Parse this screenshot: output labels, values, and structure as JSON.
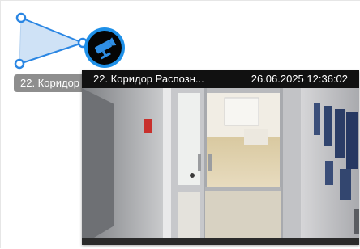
{
  "camera": {
    "label": "22. Коридор",
    "icon": "cctv-camera-icon",
    "accent_color": "#1e90e8",
    "fov_color": "#c9e0f7"
  },
  "preview": {
    "title": "22. Коридор Распозн...",
    "timestamp": "26.06.2025 12:36:02"
  }
}
